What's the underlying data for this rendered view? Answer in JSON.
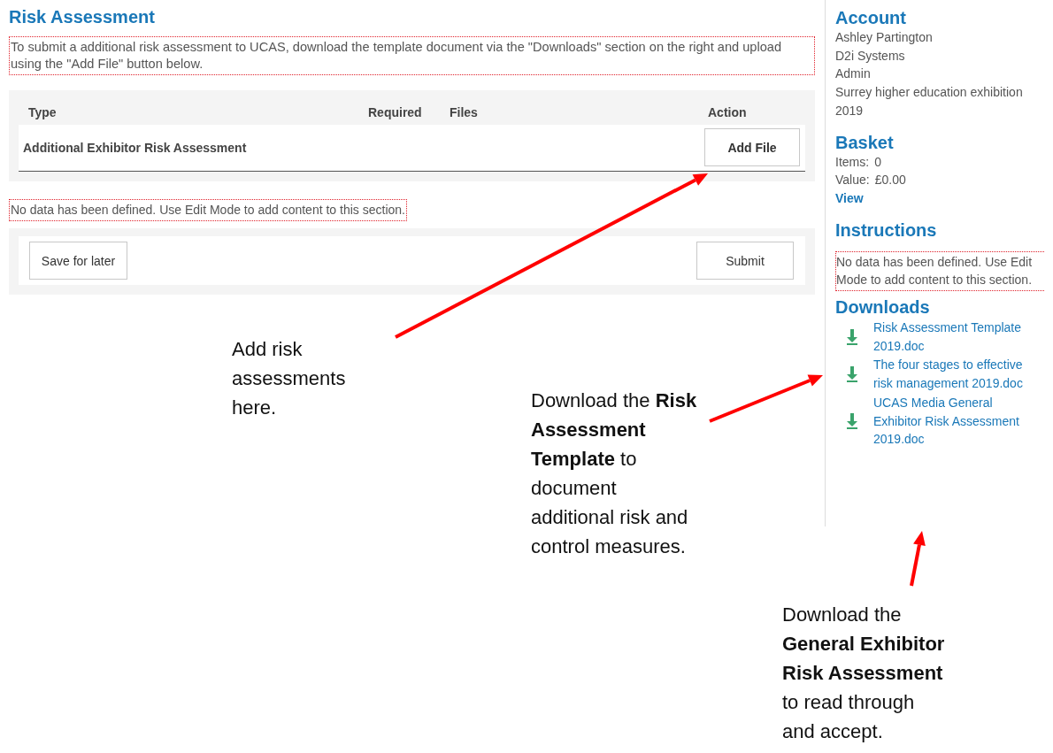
{
  "page": {
    "title": "Risk Assessment",
    "intro": "To submit a additional risk assessment to UCAS, download the template document via the \"Downloads\" section on the right and upload using the \"Add File\" button below.",
    "table": {
      "columns": [
        "Type",
        "Required",
        "Files",
        "Action"
      ],
      "rows": [
        {
          "type": "Additional Exhibitor Risk Assessment",
          "action": "Add File"
        }
      ]
    },
    "notice": "No data has been defined. Use Edit Mode to add content to this section.",
    "buttons": [
      {
        "label": "Save for later"
      },
      {
        "label": "Submit"
      }
    ]
  },
  "sidebar": {
    "account": {
      "title": "Account",
      "lines": [
        "Ashley Partington",
        "D2i Systems",
        "Admin",
        "Surrey higher education exhibition 2019"
      ]
    },
    "basket": {
      "title": "Basket",
      "rows": [
        {
          "label": "Items:",
          "value": "0"
        },
        {
          "label": "Value:",
          "value": "£0.00"
        }
      ],
      "link": "View"
    },
    "instructions": {
      "title": "Instructions",
      "notice": "No data has been defined. Use Edit Mode to add content to this section."
    },
    "downloads": {
      "title": "Downloads",
      "items": [
        "Risk Assessment Template 2019.doc",
        "The four stages to effective risk management 2019.doc",
        "UCAS Media General Exhibitor Risk Assessment 2019.doc"
      ]
    }
  },
  "annotations": [
    {
      "text": "Add risk assessments here."
    },
    {
      "text": "Download the **Risk Assessment Template** to document additional risk and control measures."
    },
    {
      "text": "Download the **General Exhibitor Risk Assessment** to read through and accept."
    }
  ]
}
